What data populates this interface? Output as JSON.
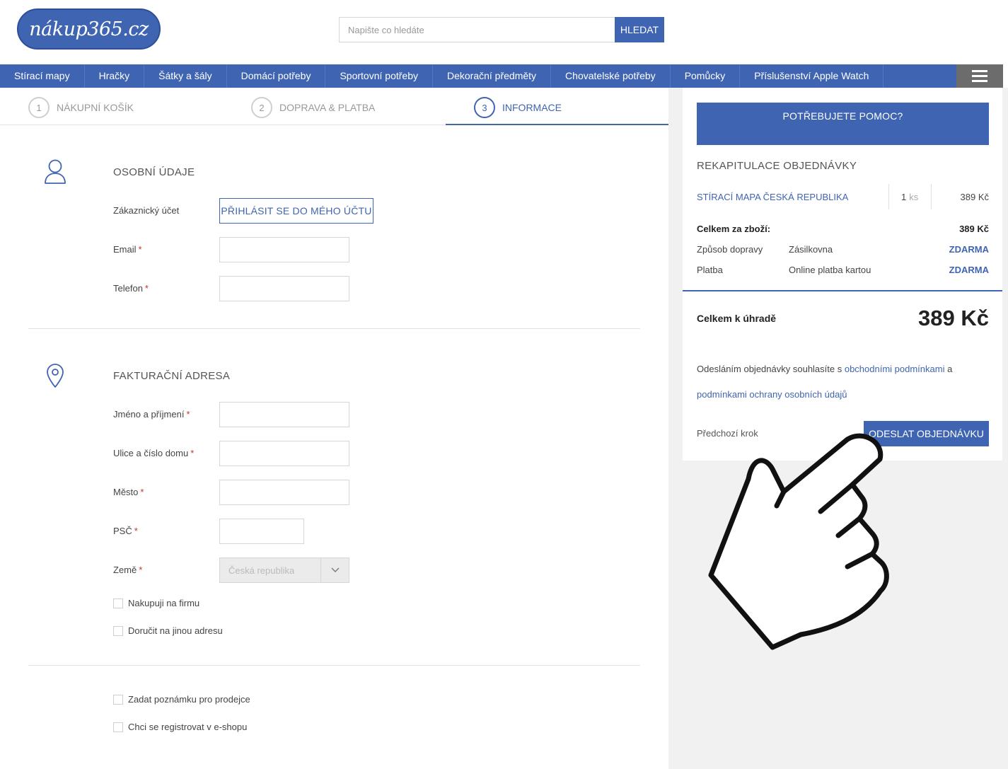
{
  "header": {
    "logo_text": "nákup365.cz",
    "search_placeholder": "Napište co hledáte",
    "search_button": "HLEDAT"
  },
  "nav": {
    "items": [
      "Stírací mapy",
      "Hračky",
      "Šátky a šály",
      "Domácí potřeby",
      "Sportovní potřeby",
      "Dekorační předměty",
      "Chovatelské potřeby",
      "Pomůcky",
      "Příslušenství Apple Watch"
    ],
    "menu_icon": "hamburger-icon"
  },
  "steps": [
    {
      "num": "1",
      "label": "NÁKUPNÍ KOŠÍK"
    },
    {
      "num": "2",
      "label": "DOPRAVA & PLATBA"
    },
    {
      "num": "3",
      "label": "INFORMACE"
    }
  ],
  "personal": {
    "icon": "user-icon",
    "title": "OSOBNÍ ÚDAJE",
    "account_label": "Zákaznický účet",
    "login_button": "PŘIHLÁSIT SE DO MÉHO ÚČTU",
    "email_label": "Email",
    "phone_label": "Telefon",
    "required_mark": "*"
  },
  "billing": {
    "icon": "map-pin-icon",
    "title": "FAKTURAČNÍ ADRESA",
    "name_label": "Jméno a příjmení",
    "street_label": "Ulice a číslo domu",
    "city_label": "Město",
    "zip_label": "PSČ",
    "country_label": "Země",
    "country_value": "Česká republika",
    "company_check": "Nakupuji na firmu",
    "other_address_check": "Doručit na jinou adresu"
  },
  "extra": {
    "note_check": "Zadat poznámku pro prodejce",
    "register_check": "Chci se registrovat v e-shopu"
  },
  "summary": {
    "help_button": "POTŘEBUJETE POMOC?",
    "title": "REKAPITULACE OBJEDNÁVKY",
    "item_name": "STÍRACÍ MAPA ČESKÁ REPUBLIKA",
    "item_qty": "1",
    "item_unit": "ks",
    "item_price": "389 Kč",
    "goods_total_label": "Celkem za zboží:",
    "goods_total_value": "389 Kč",
    "shipping_label": "Způsob dopravy",
    "shipping_value": "Zásilkovna",
    "shipping_price": "ZDARMA",
    "payment_label": "Platba",
    "payment_value": "Online platba kartou",
    "payment_price": "ZDARMA",
    "total_label": "Celkem k úhradě",
    "total_value": "389 Kč",
    "terms_before": "Odesláním objednávky souhlasíte s ",
    "terms_link1": "obchodními podmínkami",
    "terms_mid": " a",
    "terms_link2": "podmínkami ochrany osobních údajů",
    "prev_step": "Předchozí krok",
    "submit_button": "ODESLAT OBJEDNÁVKU"
  },
  "overlay": {
    "icon": "pointing-hand-icon"
  },
  "colors": {
    "brand": "#3f64b2",
    "menu_bg": "#6c6c6c",
    "sidebar_bg": "#f1f1f1",
    "required": "#c0392b"
  }
}
